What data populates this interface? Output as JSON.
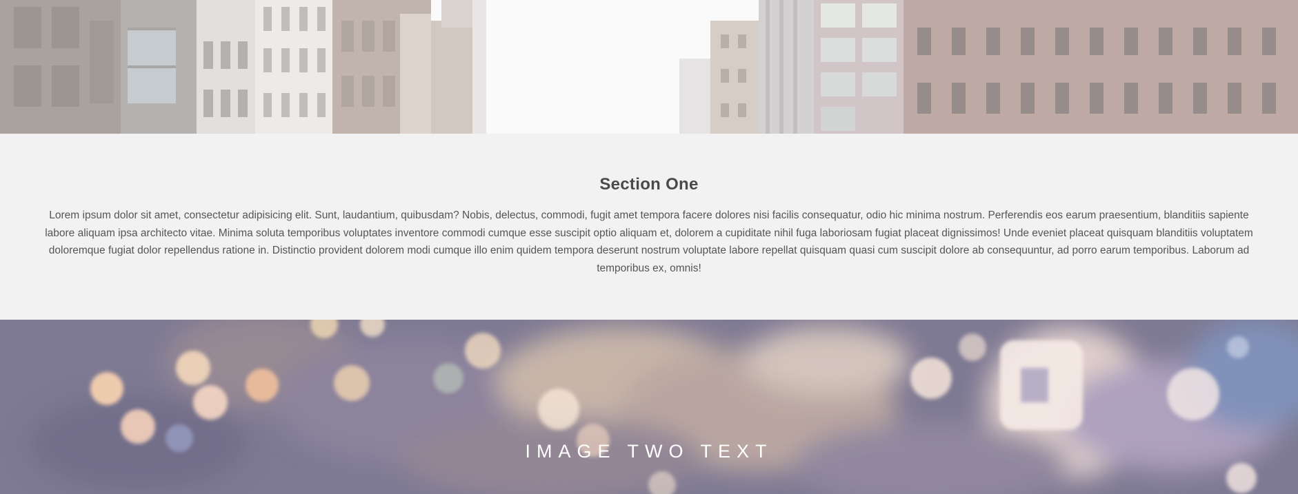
{
  "hero_one": {
    "image": "city-street-buildings-image"
  },
  "section_one": {
    "title": "Section One",
    "body": "Lorem ipsum dolor sit amet, consectetur adipisicing elit. Sunt, laudantium, quibusdam? Nobis, delectus, commodi, fugit amet tempora facere dolores nisi facilis consequatur, odio hic minima nostrum. Perferendis eos earum praesentium, blanditiis sapiente labore aliquam ipsa architecto vitae. Minima soluta temporibus voluptates inventore commodi cumque esse suscipit optio aliquam et, dolorem a cupiditate nihil fuga laboriosam fugiat placeat dignissimos! Unde eveniet placeat quisquam blanditiis voluptatem doloremque fugiat dolor repellendus ratione in. Distinctio provident dolorem modi cumque illo enim quidem tempora deserunt nostrum voluptate labore repellat quisquam quasi cum suscipit dolore ab consequuntur, ad porro earum temporibus. Laborum ad temporibus ex, omnis!",
    "background": "#f2f2f2"
  },
  "hero_two": {
    "image": "city-night-bokeh-image",
    "text": "IMAGE TWO TEXT"
  }
}
